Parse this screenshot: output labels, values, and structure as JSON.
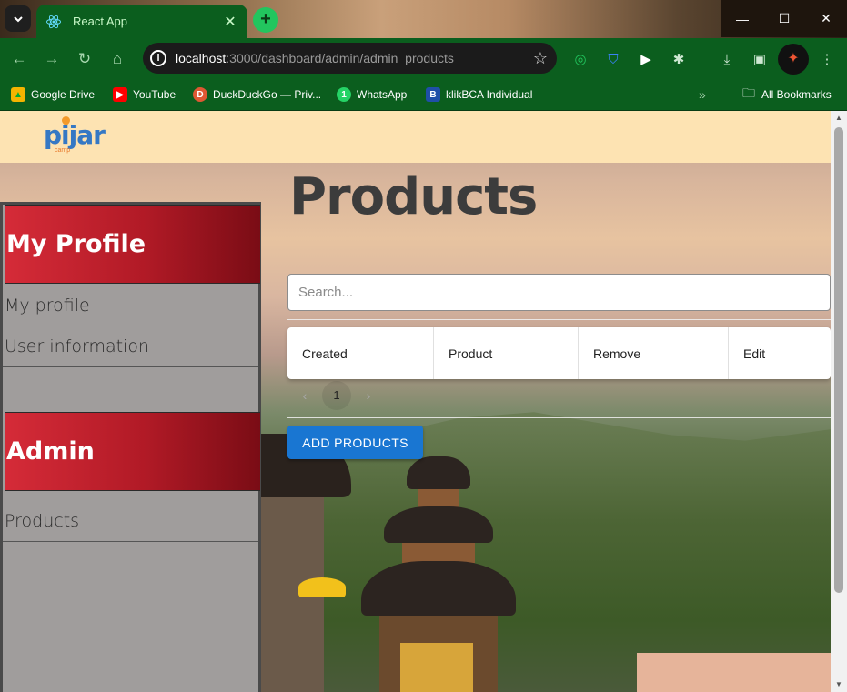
{
  "browser": {
    "tab_title": "React App",
    "url_host": "localhost",
    "url_rest": ":3000/dashboard/admin/admin_products",
    "bookmarks": [
      {
        "label": "Google Drive",
        "icon": "google-drive-icon",
        "color": "#f4b400"
      },
      {
        "label": "YouTube",
        "icon": "youtube-icon",
        "color": "#ff0000"
      },
      {
        "label": "DuckDuckGo — Priv...",
        "icon": "duckduckgo-icon",
        "color": "#de5833"
      },
      {
        "label": "WhatsApp",
        "icon": "whatsapp-icon",
        "color": "#25d366"
      },
      {
        "label": "klikBCA Individual",
        "icon": "klikbca-icon",
        "color": "#1f4fa8"
      }
    ],
    "all_bookmarks_label": "All Bookmarks"
  },
  "header": {
    "logo_text": "pijar",
    "logo_sub": "camp"
  },
  "sidebar": {
    "section1_title": "My Profile",
    "section1_items": [
      "My profile",
      "User information"
    ],
    "section2_title": "Admin",
    "section2_items": [
      "Products"
    ]
  },
  "main": {
    "title": "Products",
    "search_placeholder": "Search...",
    "columns": [
      "Created",
      "Product",
      "Remove",
      "Edit"
    ],
    "page_number": "1",
    "add_button_label": "ADD PRODUCTS"
  },
  "colors": {
    "accent": "#1976d2",
    "sidebar_header": "#b11a26",
    "chrome_green": "#0b5e1e",
    "header_bar": "#fde3b2"
  }
}
